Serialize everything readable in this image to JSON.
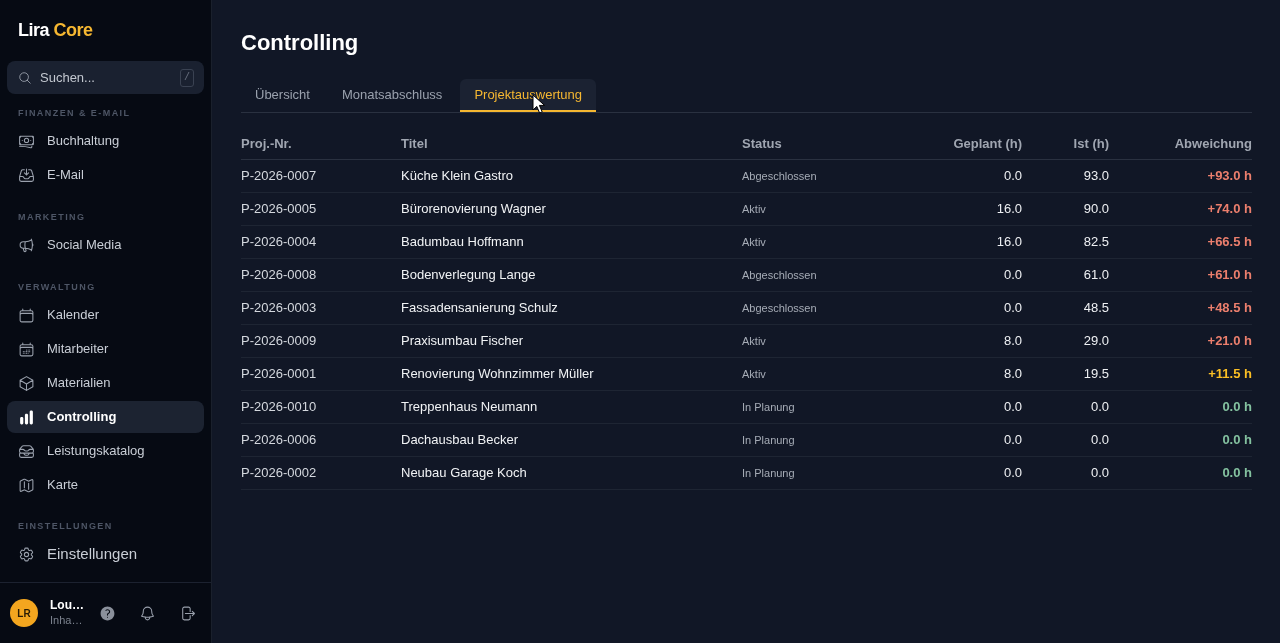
{
  "brand": {
    "name": "Lira",
    "accent": "Core"
  },
  "search": {
    "placeholder": "Suchen...",
    "shortcut": "/"
  },
  "sidebar": {
    "sections": [
      {
        "label": "FINANZEN & E-MAIL",
        "kind": "nav",
        "items": [
          {
            "label": "Buchhaltung",
            "selected": false
          },
          {
            "label": "E-Mail",
            "selected": false
          }
        ]
      },
      {
        "label": "MARKETING",
        "kind": "nav",
        "items": [
          {
            "label": "Social Media",
            "selected": false
          }
        ]
      },
      {
        "label": "VERWALTUNG",
        "kind": "nav",
        "items": [
          {
            "label": "Kalender",
            "selected": false
          },
          {
            "label": "Mitarbeiter",
            "selected": false
          },
          {
            "label": "Materialien",
            "selected": false
          },
          {
            "label": "Controlling",
            "selected": true
          },
          {
            "label": "Leistungskatalog",
            "selected": false
          },
          {
            "label": "Karte",
            "selected": false
          }
        ]
      },
      {
        "label": "EINSTELLUNGEN",
        "kind": "settings",
        "items": [
          {
            "label": "Einstellungen",
            "selected": false
          }
        ]
      }
    ]
  },
  "user": {
    "initials": "LR",
    "name": "Lou…",
    "role": "Inha…"
  },
  "page": {
    "title": "Controlling"
  },
  "tabs": [
    {
      "label": "Übersicht",
      "selected": false
    },
    {
      "label": "Monatsabschluss",
      "selected": false
    },
    {
      "label": "Projektauswertung",
      "selected": true
    }
  ],
  "table": {
    "columns": [
      {
        "label": "Proj.-Nr.",
        "kind": "id"
      },
      {
        "label": "Titel",
        "kind": "title"
      },
      {
        "label": "Status",
        "kind": "status"
      },
      {
        "label": "Geplant (h)",
        "kind": "number"
      },
      {
        "label": "Ist (h)",
        "kind": "number"
      },
      {
        "label": "Abweichung",
        "kind": "deviation"
      }
    ],
    "rows": [
      {
        "cells": [
          "P-2026-0007",
          "Küche Klein Gastro",
          "Abgeschlossen",
          "0.0",
          "93.0",
          "+93.0 h"
        ],
        "color": "#ec7f6d"
      },
      {
        "cells": [
          "P-2026-0005",
          "Bürorenovierung Wagner",
          "Aktiv",
          "16.0",
          "90.0",
          "+74.0 h"
        ],
        "color": "#ec7f6d"
      },
      {
        "cells": [
          "P-2026-0004",
          "Badumbau Hoffmann",
          "Aktiv",
          "16.0",
          "82.5",
          "+66.5 h"
        ],
        "color": "#ec7f6d"
      },
      {
        "cells": [
          "P-2026-0008",
          "Bodenverlegung Lange",
          "Abgeschlossen",
          "0.0",
          "61.0",
          "+61.0 h"
        ],
        "color": "#ec7f6d"
      },
      {
        "cells": [
          "P-2026-0003",
          "Fassadensanierung Schulz",
          "Abgeschlossen",
          "0.0",
          "48.5",
          "+48.5 h"
        ],
        "color": "#ec7f6d"
      },
      {
        "cells": [
          "P-2026-0009",
          "Praxisumbau Fischer",
          "Aktiv",
          "8.0",
          "29.0",
          "+21.0 h"
        ],
        "color": "#ec7f6d"
      },
      {
        "cells": [
          "P-2026-0001",
          "Renovierung Wohnzimmer Müller",
          "Aktiv",
          "8.0",
          "19.5",
          "+11.5 h"
        ],
        "color": "#fbbf24"
      },
      {
        "cells": [
          "P-2026-0010",
          "Treppenhaus Neumann",
          "In Planung",
          "0.0",
          "0.0",
          "0.0 h"
        ],
        "color": "#84c2a0"
      },
      {
        "cells": [
          "P-2026-0006",
          "Dachausbau Becker",
          "In Planung",
          "0.0",
          "0.0",
          "0.0 h"
        ],
        "color": "#84c2a0"
      },
      {
        "cells": [
          "P-2026-0002",
          "Neubau Garage Koch",
          "In Planung",
          "0.0",
          "0.0",
          "0.0 h"
        ],
        "color": "#84c2a0"
      }
    ]
  }
}
